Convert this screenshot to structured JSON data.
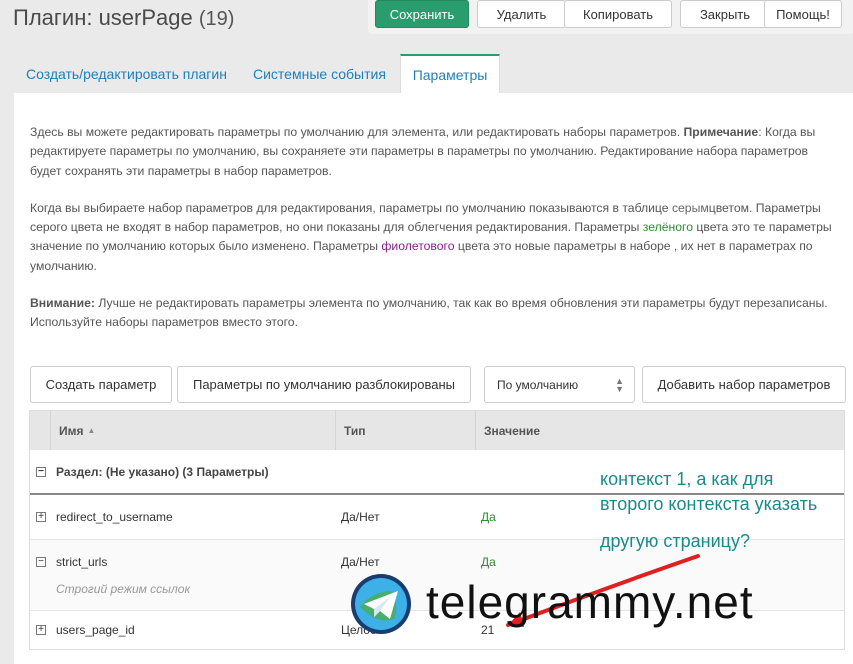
{
  "page": {
    "title": "Плагин: userPage",
    "count": "(19)"
  },
  "actions": {
    "save": "Сохранить",
    "delete": "Удалить",
    "copy": "Копировать",
    "close": "Закрыть",
    "help": "Помощь!"
  },
  "tabs": [
    {
      "label": "Создать/редактировать плагин"
    },
    {
      "label": "Системные события"
    },
    {
      "label": "Параметры"
    }
  ],
  "intro": {
    "p1a": "Здесь вы можете редактировать параметры по умолчанию для элемента, или редактировать наборы параметров. ",
    "p1b": "Примечание",
    "p1c": ": Когда вы редактируете параметры по умолчанию, вы сохраняете эти параметры в параметры по умолчанию. Редактирование набора параметров будет сохранять эти параметры в набор параметров.",
    "p2a": "Когда вы выбираете набор параметров для редактирования, параметры по умолчанию показываются в таблице ",
    "p2b": "серым",
    "p2c": "цветом. Параметры серого цвета не входят в набор параметров, но они показаны для облегчения редактирования. Параметры ",
    "p2d": "зелёного",
    "p2e": " цвета это те параметры значение по умолчанию которых было изменено. Параметры ",
    "p2f": "фиолетового",
    "p2g": " цвета это новые параметры в наборе , их нет в параметрах по умолчанию.",
    "p3a": "Внимание:",
    "p3b": " Лучше не редактировать параметры элемента по умолчанию, так как во время обновления эти параметры будут перезаписаны. Используйте наборы параметров вместо этого."
  },
  "toolbar": {
    "create": "Создать параметр",
    "unlocked": "Параметры по умолчанию разблокированы",
    "select_value": "По умолчанию",
    "add_set": "Добавить набор параметров"
  },
  "grid": {
    "headers": {
      "name": "Имя",
      "sort": "▲",
      "type": "Тип",
      "value": "Значение"
    },
    "section": "Раздел: (Не указано) (3 Параметры)",
    "rows": [
      {
        "name": "redirect_to_username",
        "type": "Да/Нет",
        "value": "Да"
      },
      {
        "name": "strict_urls",
        "type": "Да/Нет",
        "value": "Да",
        "desc": "Строгий режим ссылок"
      },
      {
        "name": "users_page_id",
        "type": "Целое",
        "value": "21"
      }
    ]
  },
  "annotation": {
    "line1": "контекст 1, а как для",
    "line2": "второго контекста указать",
    "line3": "другую страницу?"
  },
  "watermark": {
    "text": "telegrammy.net"
  },
  "colors": {
    "accent": "#2a9d6e",
    "link": "#1e7fb8",
    "annotation": "#1a8a8a",
    "arrow": "#e02020"
  }
}
